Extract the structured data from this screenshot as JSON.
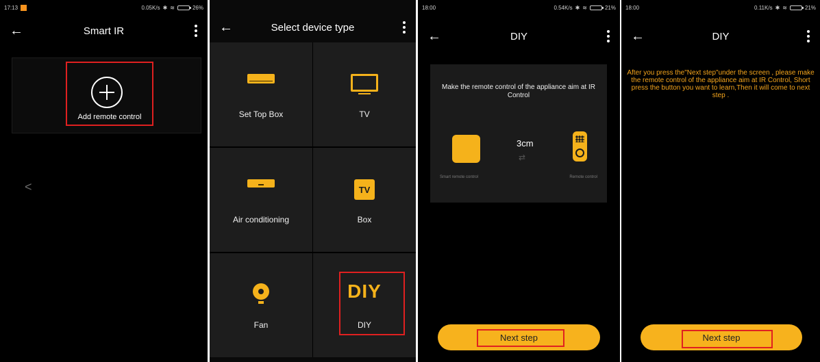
{
  "screens": [
    {
      "status": {
        "time": "17:13",
        "network": "0.05K/s",
        "battery": "26%"
      },
      "title": "Smart IR",
      "add_remote_label": "Add remote control",
      "side_chevron": "<"
    },
    {
      "title": "Select device type",
      "devices": [
        {
          "label": "Set Top Box",
          "icon": "set-top-box-icon"
        },
        {
          "label": "TV",
          "icon": "tv-icon"
        },
        {
          "label": "Air conditioning",
          "icon": "air-conditioner-icon"
        },
        {
          "label": "Box",
          "icon": "tv-box-icon",
          "icon_text": "TV"
        },
        {
          "label": "Fan",
          "icon": "fan-icon"
        },
        {
          "label": "DIY",
          "icon": "diy-icon",
          "icon_text": "DIY"
        }
      ]
    },
    {
      "status": {
        "time": "18:00",
        "network": "0.54K/s",
        "battery": "21%"
      },
      "title": "DIY",
      "instruction": "Make the remote control of the appliance aim at IR Control",
      "distance": "3cm",
      "left_caption": "Smart remote control",
      "right_caption": "Remote control",
      "next_label": "Next step"
    },
    {
      "status": {
        "time": "18:00",
        "network": "0.11K/s",
        "battery": "21%"
      },
      "title": "DIY",
      "instruction": "After you press the\"Next step\"under the screen , please make the remote control of the appliance aim at IR Control, Short press the button you want to learn,Then it will come to next step .",
      "next_label": "Next step"
    }
  ],
  "colors": {
    "accent": "#f5b21b",
    "highlight_box": "#e02020",
    "background": "#000000"
  }
}
